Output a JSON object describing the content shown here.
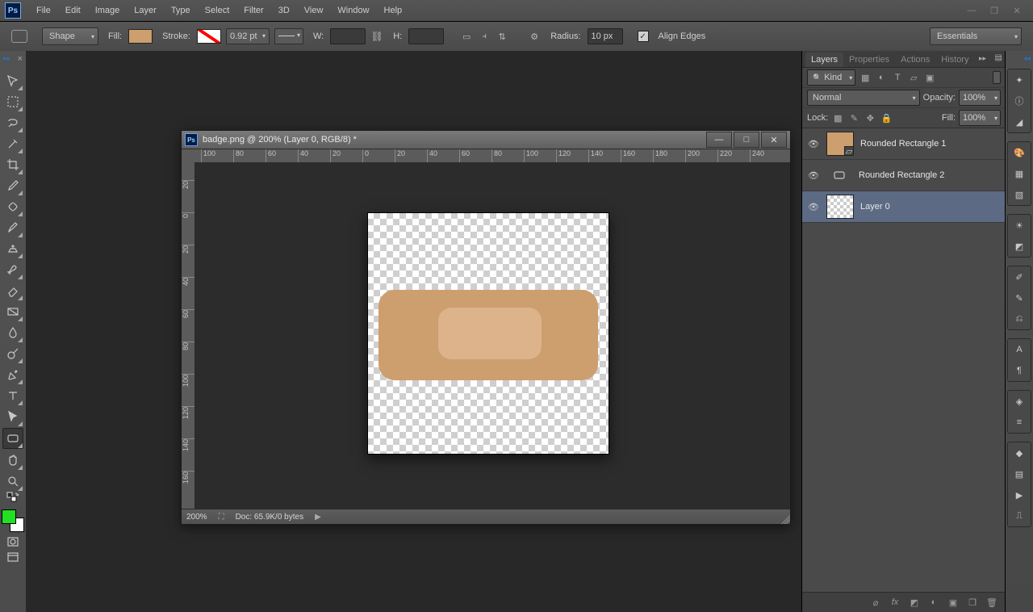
{
  "app_logo_text": "Ps",
  "menu": [
    "File",
    "Edit",
    "Image",
    "Layer",
    "Type",
    "Select",
    "Filter",
    "3D",
    "View",
    "Window",
    "Help"
  ],
  "options": {
    "mode": "Shape",
    "fill_label": "Fill:",
    "fill_color": "#cd9e6e",
    "stroke_label": "Stroke:",
    "stroke_weight": "0.92 pt",
    "w_label": "W:",
    "h_label": "H:",
    "radius_label": "Radius:",
    "radius_value": "10 px",
    "align_edges_label": "Align Edges",
    "workspace": "Essentials"
  },
  "document": {
    "title": "badge.png @ 200% (Layer 0, RGB/8) *",
    "zoom": "200%",
    "doc_info": "Doc: 65.9K/0 bytes",
    "ruler_h": [
      "100",
      "80",
      "60",
      "40",
      "20",
      "0",
      "20",
      "40",
      "60",
      "80",
      "100",
      "120",
      "140",
      "160",
      "180",
      "200",
      "220",
      "240"
    ],
    "ruler_v": [
      "20",
      "0",
      "20",
      "40",
      "60",
      "80",
      "100",
      "120",
      "140",
      "160"
    ]
  },
  "layers_panel": {
    "tabs": [
      "Layers",
      "Properties",
      "Actions",
      "History"
    ],
    "kind": "Kind",
    "blend_mode": "Normal",
    "opacity_label": "Opacity:",
    "opacity": "100%",
    "lock_label": "Lock:",
    "fill_label": "Fill:",
    "fill": "100%",
    "layers": [
      {
        "name": "Rounded Rectangle 1",
        "type": "shape-thumb"
      },
      {
        "name": "Rounded Rectangle 2",
        "type": "shape-icon"
      },
      {
        "name": "Layer 0",
        "type": "checker"
      }
    ]
  }
}
